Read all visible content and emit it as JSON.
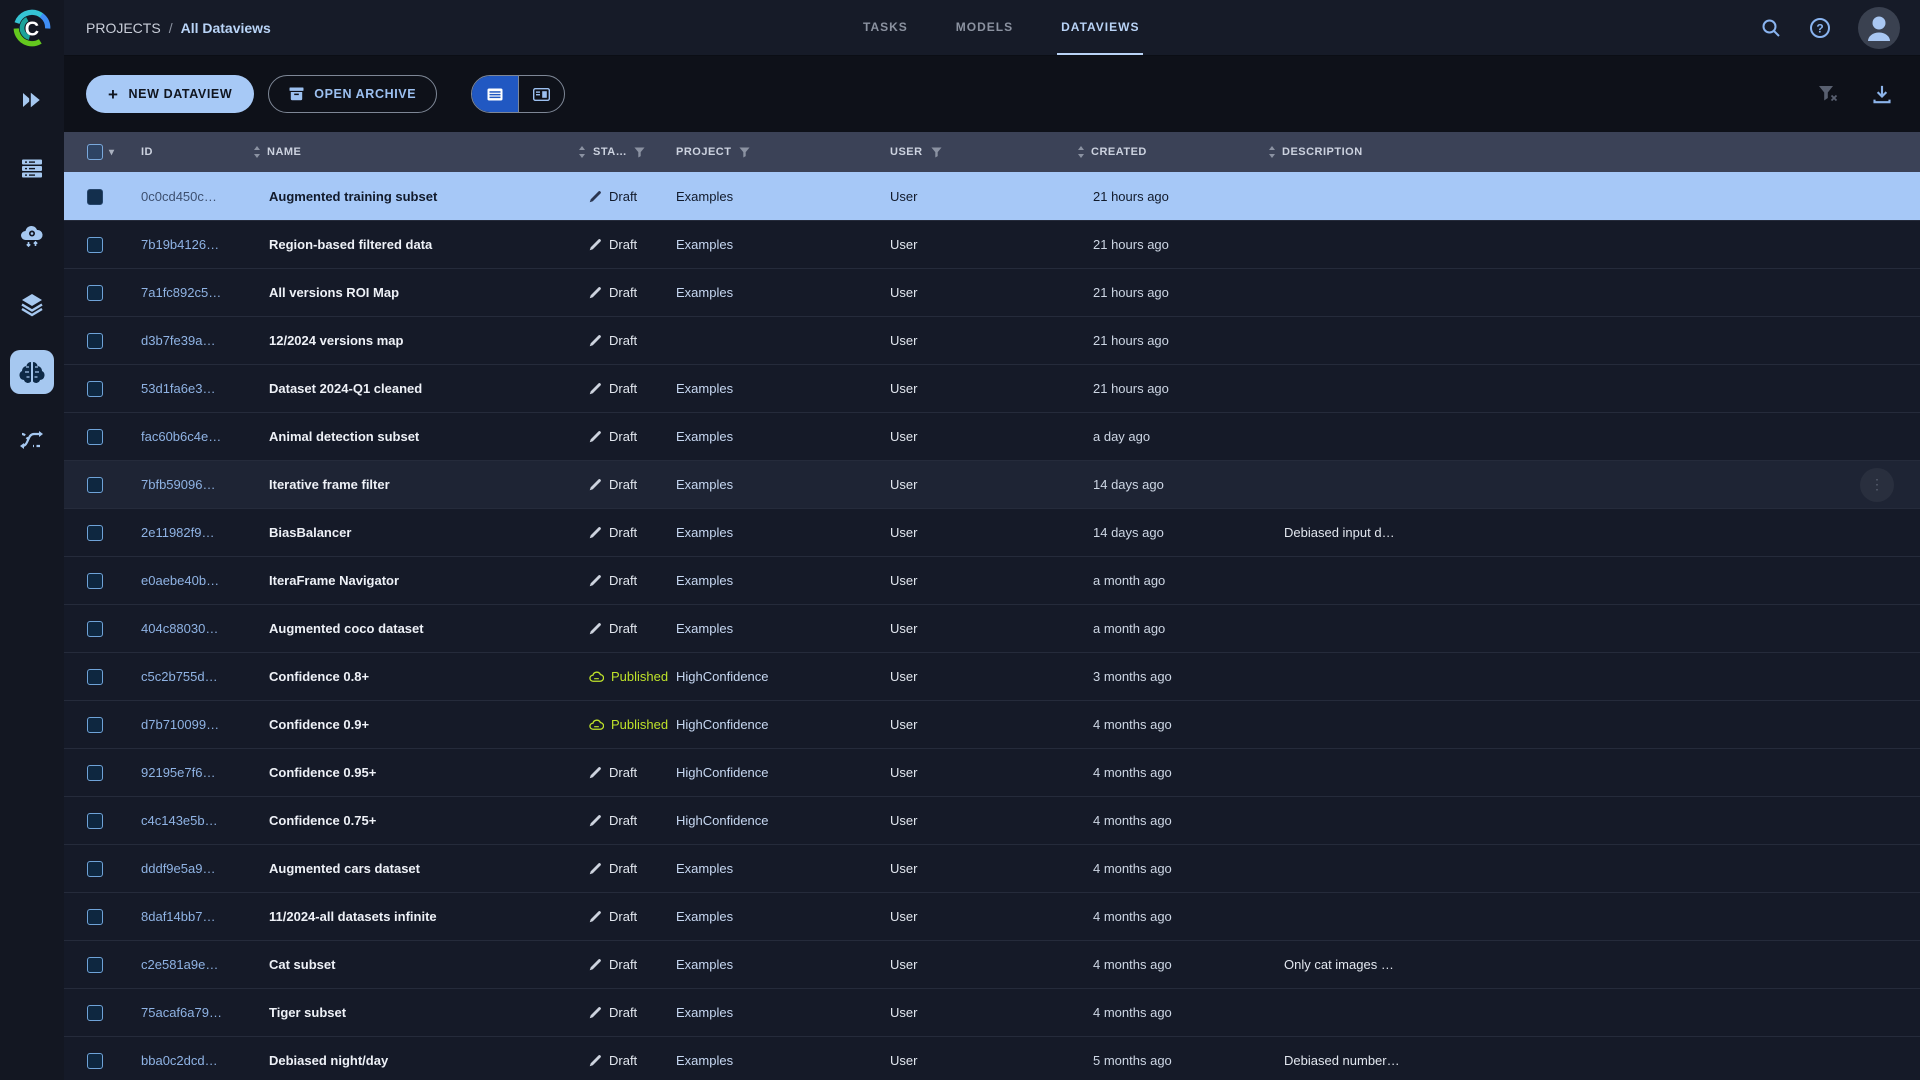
{
  "colors": {
    "selected_row": "#a6c8f7",
    "published_green": "#bfe32a",
    "primary_button_bg": "#a7c9f6",
    "active_segment_blue": "#2158c2",
    "link_blue": "#8fb3e4",
    "header_bg": "#3b4257"
  },
  "branding": {
    "logo_letter": "C"
  },
  "breadcrumb": {
    "root": "PROJECTS",
    "separator": "/",
    "current": "All Dataviews"
  },
  "nav_tabs": [
    {
      "label": "TASKS",
      "active": false
    },
    {
      "label": "MODELS",
      "active": false
    },
    {
      "label": "DATAVIEWS",
      "active": true
    }
  ],
  "toolbar": {
    "plus_glyph": "+",
    "new_dataview_label": "NEW DATAVIEW",
    "open_archive_label": "OPEN ARCHIVE"
  },
  "header_select": {
    "caret_glyph": "▾"
  },
  "help_glyph": "?",
  "kebab_glyph": "⋮",
  "table": {
    "columns": [
      {
        "label": "ID"
      },
      {
        "label": "NAME"
      },
      {
        "label": "STA…"
      },
      {
        "label": "PROJECT"
      },
      {
        "label": "USER"
      },
      {
        "label": "CREATED"
      },
      {
        "label": "DESCRIPTION"
      }
    ],
    "rows": [
      {
        "id": "0c0cd450c…",
        "name": "Augmented training subset",
        "status": "Draft",
        "project": "Examples",
        "user": "User",
        "created": "21 hours ago",
        "description": "",
        "selected": true,
        "hovered": false
      },
      {
        "id": "7b19b4126…",
        "name": "Region-based filtered data",
        "status": "Draft",
        "project": "Examples",
        "user": "User",
        "created": "21 hours ago",
        "description": "",
        "selected": false,
        "hovered": false
      },
      {
        "id": "7a1fc892c5…",
        "name": "All versions ROI Map",
        "status": "Draft",
        "project": "Examples",
        "user": "User",
        "created": "21 hours ago",
        "description": "",
        "selected": false,
        "hovered": false
      },
      {
        "id": "d3b7fe39a…",
        "name": "12/2024 versions map",
        "status": "Draft",
        "project": "",
        "user": "User",
        "created": "21 hours ago",
        "description": "",
        "selected": false,
        "hovered": false
      },
      {
        "id": "53d1fa6e3…",
        "name": "Dataset 2024-Q1 cleaned",
        "status": "Draft",
        "project": "Examples",
        "user": "User",
        "created": "21 hours ago",
        "description": "",
        "selected": false,
        "hovered": false
      },
      {
        "id": "fac60b6c4e…",
        "name": "Animal detection subset",
        "status": "Draft",
        "project": "Examples",
        "user": "User",
        "created": "a day ago",
        "description": "",
        "selected": false,
        "hovered": false
      },
      {
        "id": "7bfb59096…",
        "name": "Iterative frame filter",
        "status": "Draft",
        "project": "Examples",
        "user": "User",
        "created": "14 days ago",
        "description": "",
        "selected": false,
        "hovered": true
      },
      {
        "id": "2e11982f9…",
        "name": "BiasBalancer",
        "status": "Draft",
        "project": "Examples",
        "user": "User",
        "created": "14 days ago",
        "description": "Debiased input d…",
        "selected": false,
        "hovered": false
      },
      {
        "id": "e0aebe40b…",
        "name": "IteraFrame Navigator",
        "status": "Draft",
        "project": "Examples",
        "user": "User",
        "created": "a month ago",
        "description": "",
        "selected": false,
        "hovered": false
      },
      {
        "id": "404c88030…",
        "name": "Augmented coco dataset",
        "status": "Draft",
        "project": "Examples",
        "user": "User",
        "created": "a month ago",
        "description": "",
        "selected": false,
        "hovered": false
      },
      {
        "id": "c5c2b755d…",
        "name": "Confidence 0.8+",
        "status": "Published",
        "project": "HighConfidence",
        "user": "User",
        "created": "3 months ago",
        "description": "",
        "selected": false,
        "hovered": false
      },
      {
        "id": "d7b710099…",
        "name": "Confidence 0.9+",
        "status": "Published",
        "project": "HighConfidence",
        "user": "User",
        "created": "4 months ago",
        "description": "",
        "selected": false,
        "hovered": false
      },
      {
        "id": "92195e7f6…",
        "name": "Confidence 0.95+",
        "status": "Draft",
        "project": "HighConfidence",
        "user": "User",
        "created": "4 months ago",
        "description": "",
        "selected": false,
        "hovered": false
      },
      {
        "id": "c4c143e5b…",
        "name": "Confidence 0.75+",
        "status": "Draft",
        "project": "HighConfidence",
        "user": "User",
        "created": "4 months ago",
        "description": "",
        "selected": false,
        "hovered": false
      },
      {
        "id": "dddf9e5a9…",
        "name": "Augmented cars dataset",
        "status": "Draft",
        "project": "Examples",
        "user": "User",
        "created": "4 months ago",
        "description": "",
        "selected": false,
        "hovered": false
      },
      {
        "id": "8daf14bb7…",
        "name": "11/2024-all datasets infinite",
        "status": "Draft",
        "project": "Examples",
        "user": "User",
        "created": "4 months ago",
        "description": "",
        "selected": false,
        "hovered": false
      },
      {
        "id": "c2e581a9e…",
        "name": "Cat subset",
        "status": "Draft",
        "project": "Examples",
        "user": "User",
        "created": "4 months ago",
        "description": "Only cat images …",
        "selected": false,
        "hovered": false
      },
      {
        "id": "75acaf6a79…",
        "name": "Tiger subset",
        "status": "Draft",
        "project": "Examples",
        "user": "User",
        "created": "4 months ago",
        "description": "",
        "selected": false,
        "hovered": false
      },
      {
        "id": "bba0c2dcd…",
        "name": "Debiased night/day",
        "status": "Draft",
        "project": "Examples",
        "user": "User",
        "created": "5 months ago",
        "description": "Debiased number…",
        "selected": false,
        "hovered": false
      }
    ]
  }
}
